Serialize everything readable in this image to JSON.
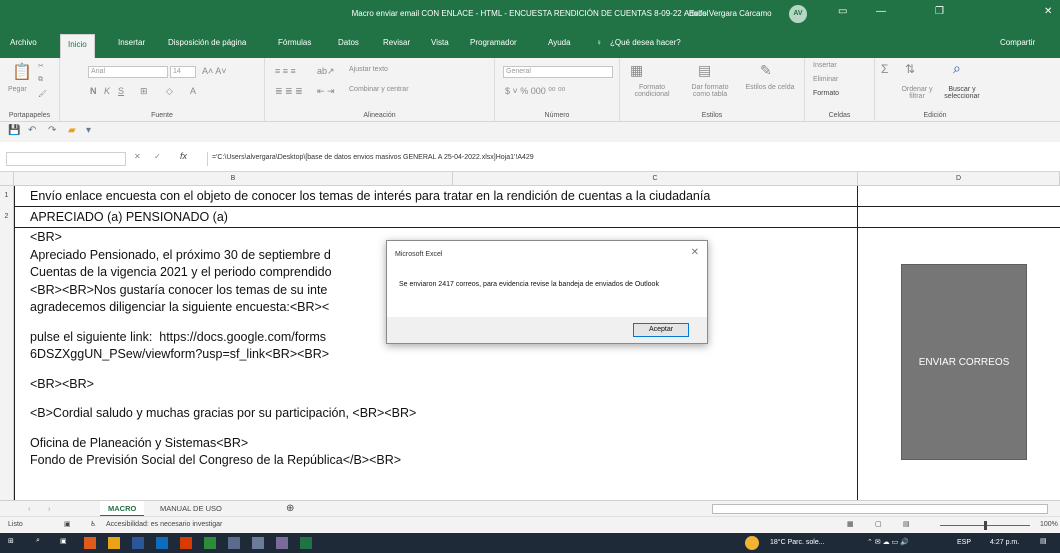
{
  "window": {
    "title": "Macro enviar email CON ENLACE - HTML - ENCUESTA RENDICIÓN DE CUENTAS 8-09-22 - Excel",
    "user": "Adolfo Vergara Cárcamo",
    "avatar": "AV"
  },
  "tabs": [
    "Archivo",
    "Inicio",
    "Insertar",
    "Disposición de página",
    "Fórmulas",
    "Datos",
    "Revisar",
    "Vista",
    "Programador",
    "Ayuda"
  ],
  "tell_me": "¿Qué desea hacer?",
  "share": "Compartir",
  "ribbon": {
    "paste": "Pegar",
    "font_name": "Arial",
    "font_size": "14",
    "wrap_text": "Ajustar texto",
    "merge_center": "Combinar y centrar",
    "number_format": "General",
    "cond_format": "Formato condicional",
    "table_format": "Dar formato como tabla",
    "cell_styles": "Estilos de celda",
    "insert": "Insertar",
    "delete": "Eliminar",
    "format": "Formato",
    "sort_filter": "Ordenar y filtrar",
    "find_select": "Buscar y seleccionar",
    "groups": [
      "Portapapeles",
      "Fuente",
      "Alineación",
      "Número",
      "Estilos",
      "Celdas",
      "Edición"
    ]
  },
  "formula_bar": {
    "fx": "fx",
    "content": "='C:\\Users\\alvergara\\Desktop\\[base de datos envios masivos GENERAL A 25-04-2022.xlsx]Hoja1'!A429"
  },
  "columns": [
    "B",
    "C",
    "D"
  ],
  "rows": [
    "1",
    "2"
  ],
  "cells": {
    "row1": "Envío enlace encuesta con el objeto de conocer los temas de interés para tratar en la  rendición de cuentas a la ciudadanía",
    "row2": "APRECIADO (a) PENSIONADO (a)",
    "body_lines": [
      "<BR>",
      "Apreciado Pensionado, el próximo 30 de septiembre d                                                         blica de Rendición de",
      "Cuentas de la vigencia 2021 y el periodo comprendido                                                         nte año.",
      "<BR><BR>Nos gustaría conocer los temas de su inte                                                         para esto",
      "agradecemos diligenciar la siguiente encuesta:<BR><",
      "",
      "pulse el siguiente link:  https://docs.google.com/forms                                        wBf6cO03-",
      "6DSZXggUN_PSew/viewform?usp=sf_link<BR><BR>",
      "",
      "<BR><BR>",
      "",
      "<B>Cordial saludo y muchas gracias por su participación, <BR><BR>",
      "",
      "Oficina de Planeación y Sistemas<BR>",
      "Fondo de Previsión Social del Congreso de la República</B><BR>"
    ]
  },
  "send_button": "ENVIAR CORREOS",
  "dialog": {
    "title": "Microsoft Excel",
    "message": "Se enviaron 2417 correos, para evidencia revise la bandeja de enviados de Outlook",
    "ok": "Aceptar"
  },
  "sheet_tabs": [
    "MACRO",
    "MANUAL DE USO"
  ],
  "status": {
    "ready": "Listo",
    "accessibility": "Accesibilidad: es necesario investigar",
    "zoom": "100%"
  },
  "taskbar": {
    "weather": "18°C  Parc. sole...",
    "lang": "ESP",
    "time": "4:27 p.m."
  }
}
